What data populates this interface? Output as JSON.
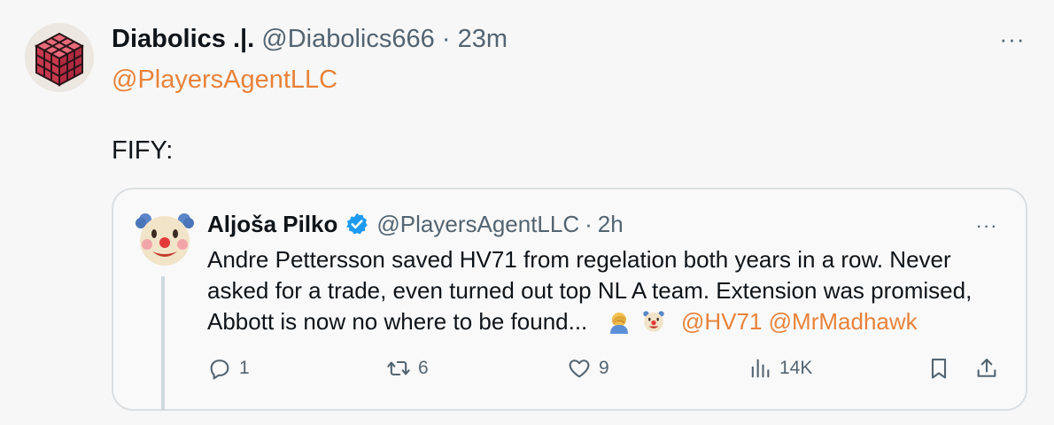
{
  "tweet": {
    "author_name": "Diabolics .|.",
    "author_handle": "@Diabolics666",
    "separator": "·",
    "time": "23m",
    "more_label": "···",
    "reply_to": "@PlayersAgentLLC",
    "text": "FIFY:"
  },
  "quote": {
    "author_name": "Aljoša Pilko",
    "author_handle": "@PlayersAgentLLC",
    "separator": "·",
    "time": "2h",
    "more_label": "···",
    "text_line1": "Andre Pettersson saved HV71 from regelation both years in a row. Never",
    "text_line2": "asked for a trade, even turned out top NL A team. Extension was promised,",
    "text_line3": "Abbott is now no where to be found...",
    "emojis": [
      "facepalm-emoji",
      "clown-emoji"
    ],
    "mention1": "@HV71",
    "mention2": "@MrMadhawk",
    "actions": {
      "replies": "1",
      "retweets": "6",
      "likes": "9",
      "views": "14K"
    }
  },
  "colors": {
    "link": "#e8833a",
    "muted": "#536471",
    "verified": "#1d9bf0"
  }
}
